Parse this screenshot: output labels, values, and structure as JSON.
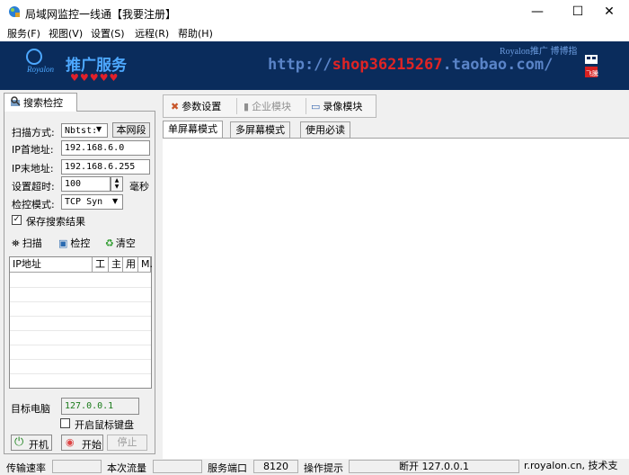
{
  "window": {
    "title": "局域网监控一线通【我要注册】",
    "minimize": "—",
    "maximize": "☐",
    "close": "✕"
  },
  "menu": [
    "服务(F)",
    "视图(V)",
    "设置(S)",
    "远程(R)",
    "帮助(H)"
  ],
  "banner": {
    "service": "推广服务",
    "logo_text": "Royalon",
    "hearts": "♥♥♥♥♥",
    "url_prefix": "http://",
    "url_red": "shop36215267",
    "url_suffix": ".taobao.com/",
    "small_text": "Royalon推广 博博指",
    "corner_text": "飞騰"
  },
  "left": {
    "tab_label": "搜索检控",
    "scan_mode_label": "扫描方式:",
    "scan_mode_value": "Nbtst:",
    "local_segment_button": "本网段",
    "ip_start_label": "IP首地址:",
    "ip_start_value": "192.168.6.0",
    "ip_end_label": "IP末地址:",
    "ip_end_value": "192.168.6.255",
    "timeout_label": "设置超时:",
    "timeout_value": "100",
    "timeout_unit": "毫秒",
    "detect_mode_label": "检控模式:",
    "detect_mode_value": "TCP Syn",
    "save_results_label": "保存搜索结果",
    "scan_button": "扫描",
    "monitor_button": "检控",
    "clear_button": "清空",
    "table_headers": [
      "IP地址",
      "工",
      "主",
      "用",
      "M."
    ],
    "target_label": "目标电脑",
    "target_value": "127.0.0.1",
    "keyboard_label": "开启鼠标键盘",
    "power_button": "开机",
    "start_button": "开始",
    "stop_button": "停止"
  },
  "toolbar": {
    "params": "参数设置",
    "enterprise": "企业模块",
    "record": "录像模块"
  },
  "tabs": [
    "单屏幕模式",
    "多屏幕模式",
    "使用必读"
  ],
  "status": {
    "rate_label": "传输速率",
    "traffic_label": "本次流量",
    "port_label": "服务端口",
    "port_value": "8120",
    "hint_label": "操作提示",
    "hint_value": "断开 127.0.0.1",
    "site_text": "r.royalon.cn, 技术支"
  },
  "colors": {
    "banner_bg": "#0a2c5c",
    "url_red": "#e02424",
    "url_blue": "#5a84c8",
    "target_text": "#1a7a1a"
  }
}
